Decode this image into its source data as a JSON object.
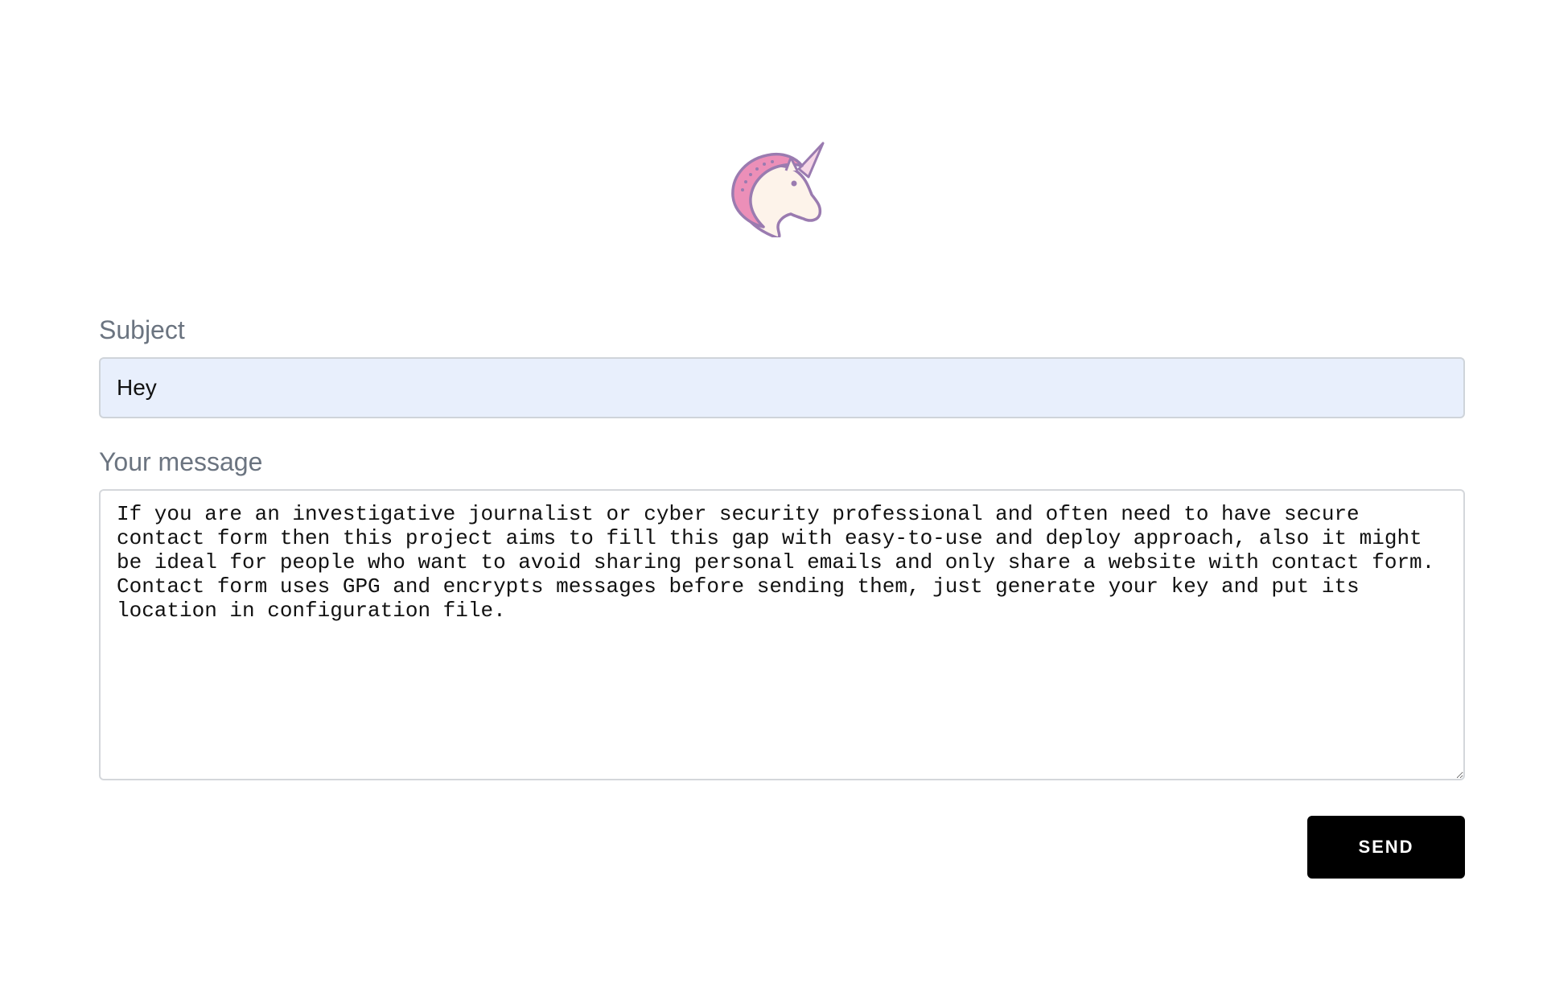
{
  "logo": {
    "icon": "unicorn-icon",
    "colors": {
      "mane": "#ec8fb8",
      "outline": "#9a7bb0",
      "face": "#fdf3ea"
    }
  },
  "form": {
    "subject": {
      "label": "Subject",
      "value": "Hey"
    },
    "message": {
      "label": "Your message",
      "value": "If you are an investigative journalist or cyber security professional and often need to have secure contact form then this project aims to fill this gap with easy-to-use and deploy approach, also it might be ideal for people who want to avoid sharing personal emails and only share a website with contact form. Contact form uses GPG and encrypts messages before sending them, just generate your key and put its location in configuration file."
    },
    "send_label": "SEND"
  }
}
